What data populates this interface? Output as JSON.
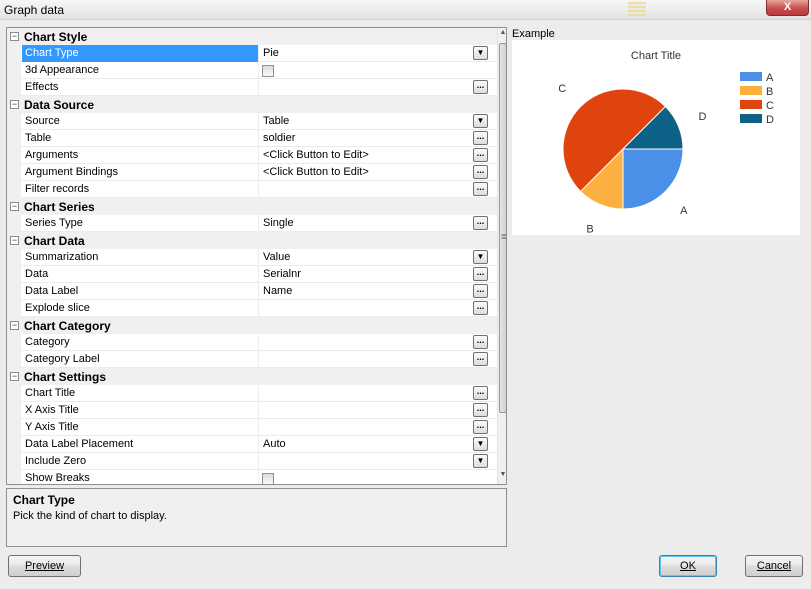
{
  "window": {
    "title": "Graph data",
    "close_label": "X"
  },
  "grid": {
    "rows": [
      {
        "kind": "category",
        "label": "Chart Style"
      },
      {
        "kind": "prop",
        "name": "Chart Type",
        "value": "Pie",
        "button": "dropdown",
        "selected": true
      },
      {
        "kind": "prop",
        "name": "3d Appearance",
        "value": "",
        "checkbox": true
      },
      {
        "kind": "prop",
        "name": "Effects",
        "value": "",
        "button": "ellipsis"
      },
      {
        "kind": "category",
        "label": "Data Source"
      },
      {
        "kind": "prop",
        "name": "Source",
        "value": "Table",
        "button": "dropdown"
      },
      {
        "kind": "prop",
        "name": "Table",
        "value": "soldier",
        "button": "ellipsis"
      },
      {
        "kind": "prop",
        "name": "Arguments",
        "value": "<Click Button to Edit>",
        "button": "ellipsis"
      },
      {
        "kind": "prop",
        "name": "Argument Bindings",
        "value": "<Click Button to Edit>",
        "button": "ellipsis"
      },
      {
        "kind": "prop",
        "name": "Filter records",
        "value": "",
        "button": "ellipsis"
      },
      {
        "kind": "category",
        "label": "Chart Series"
      },
      {
        "kind": "prop",
        "name": "Series Type",
        "value": "Single",
        "button": "ellipsis"
      },
      {
        "kind": "category",
        "label": "Chart Data"
      },
      {
        "kind": "prop",
        "name": "Summarization",
        "value": "Value",
        "button": "dropdown"
      },
      {
        "kind": "prop",
        "name": "Data",
        "value": "Serialnr",
        "button": "ellipsis"
      },
      {
        "kind": "prop",
        "name": "Data Label",
        "value": "Name",
        "button": "ellipsis"
      },
      {
        "kind": "prop",
        "name": "Explode slice",
        "value": "",
        "button": "ellipsis"
      },
      {
        "kind": "category",
        "label": "Chart Category"
      },
      {
        "kind": "prop",
        "name": "Category",
        "value": "",
        "button": "ellipsis"
      },
      {
        "kind": "prop",
        "name": "Category Label",
        "value": "",
        "button": "ellipsis"
      },
      {
        "kind": "category",
        "label": "Chart Settings"
      },
      {
        "kind": "prop",
        "name": "Chart Title",
        "value": "",
        "button": "ellipsis"
      },
      {
        "kind": "prop",
        "name": "X Axis Title",
        "value": "",
        "button": "ellipsis"
      },
      {
        "kind": "prop",
        "name": "Y Axis Title",
        "value": "",
        "button": "ellipsis"
      },
      {
        "kind": "prop",
        "name": "Data Label Placement",
        "value": "Auto",
        "button": "dropdown"
      },
      {
        "kind": "prop",
        "name": "Include Zero",
        "value": "",
        "button": "dropdown"
      },
      {
        "kind": "prop",
        "name": "Show Breaks",
        "value": "",
        "checkbox": true
      }
    ]
  },
  "help": {
    "title": "Chart Type",
    "description": "Pick the kind of chart to display."
  },
  "example": {
    "label": "Example"
  },
  "chart_data": {
    "type": "pie",
    "title": "Chart Title",
    "categories": [
      "A",
      "B",
      "C",
      "D"
    ],
    "values": [
      25,
      12.5,
      50,
      12.5
    ],
    "colors": [
      "#4a90e8",
      "#fbb040",
      "#e0440e",
      "#0e6187"
    ],
    "legend": "right"
  },
  "buttons": {
    "preview": "Preview",
    "ok": "OK",
    "cancel": "Cancel"
  }
}
